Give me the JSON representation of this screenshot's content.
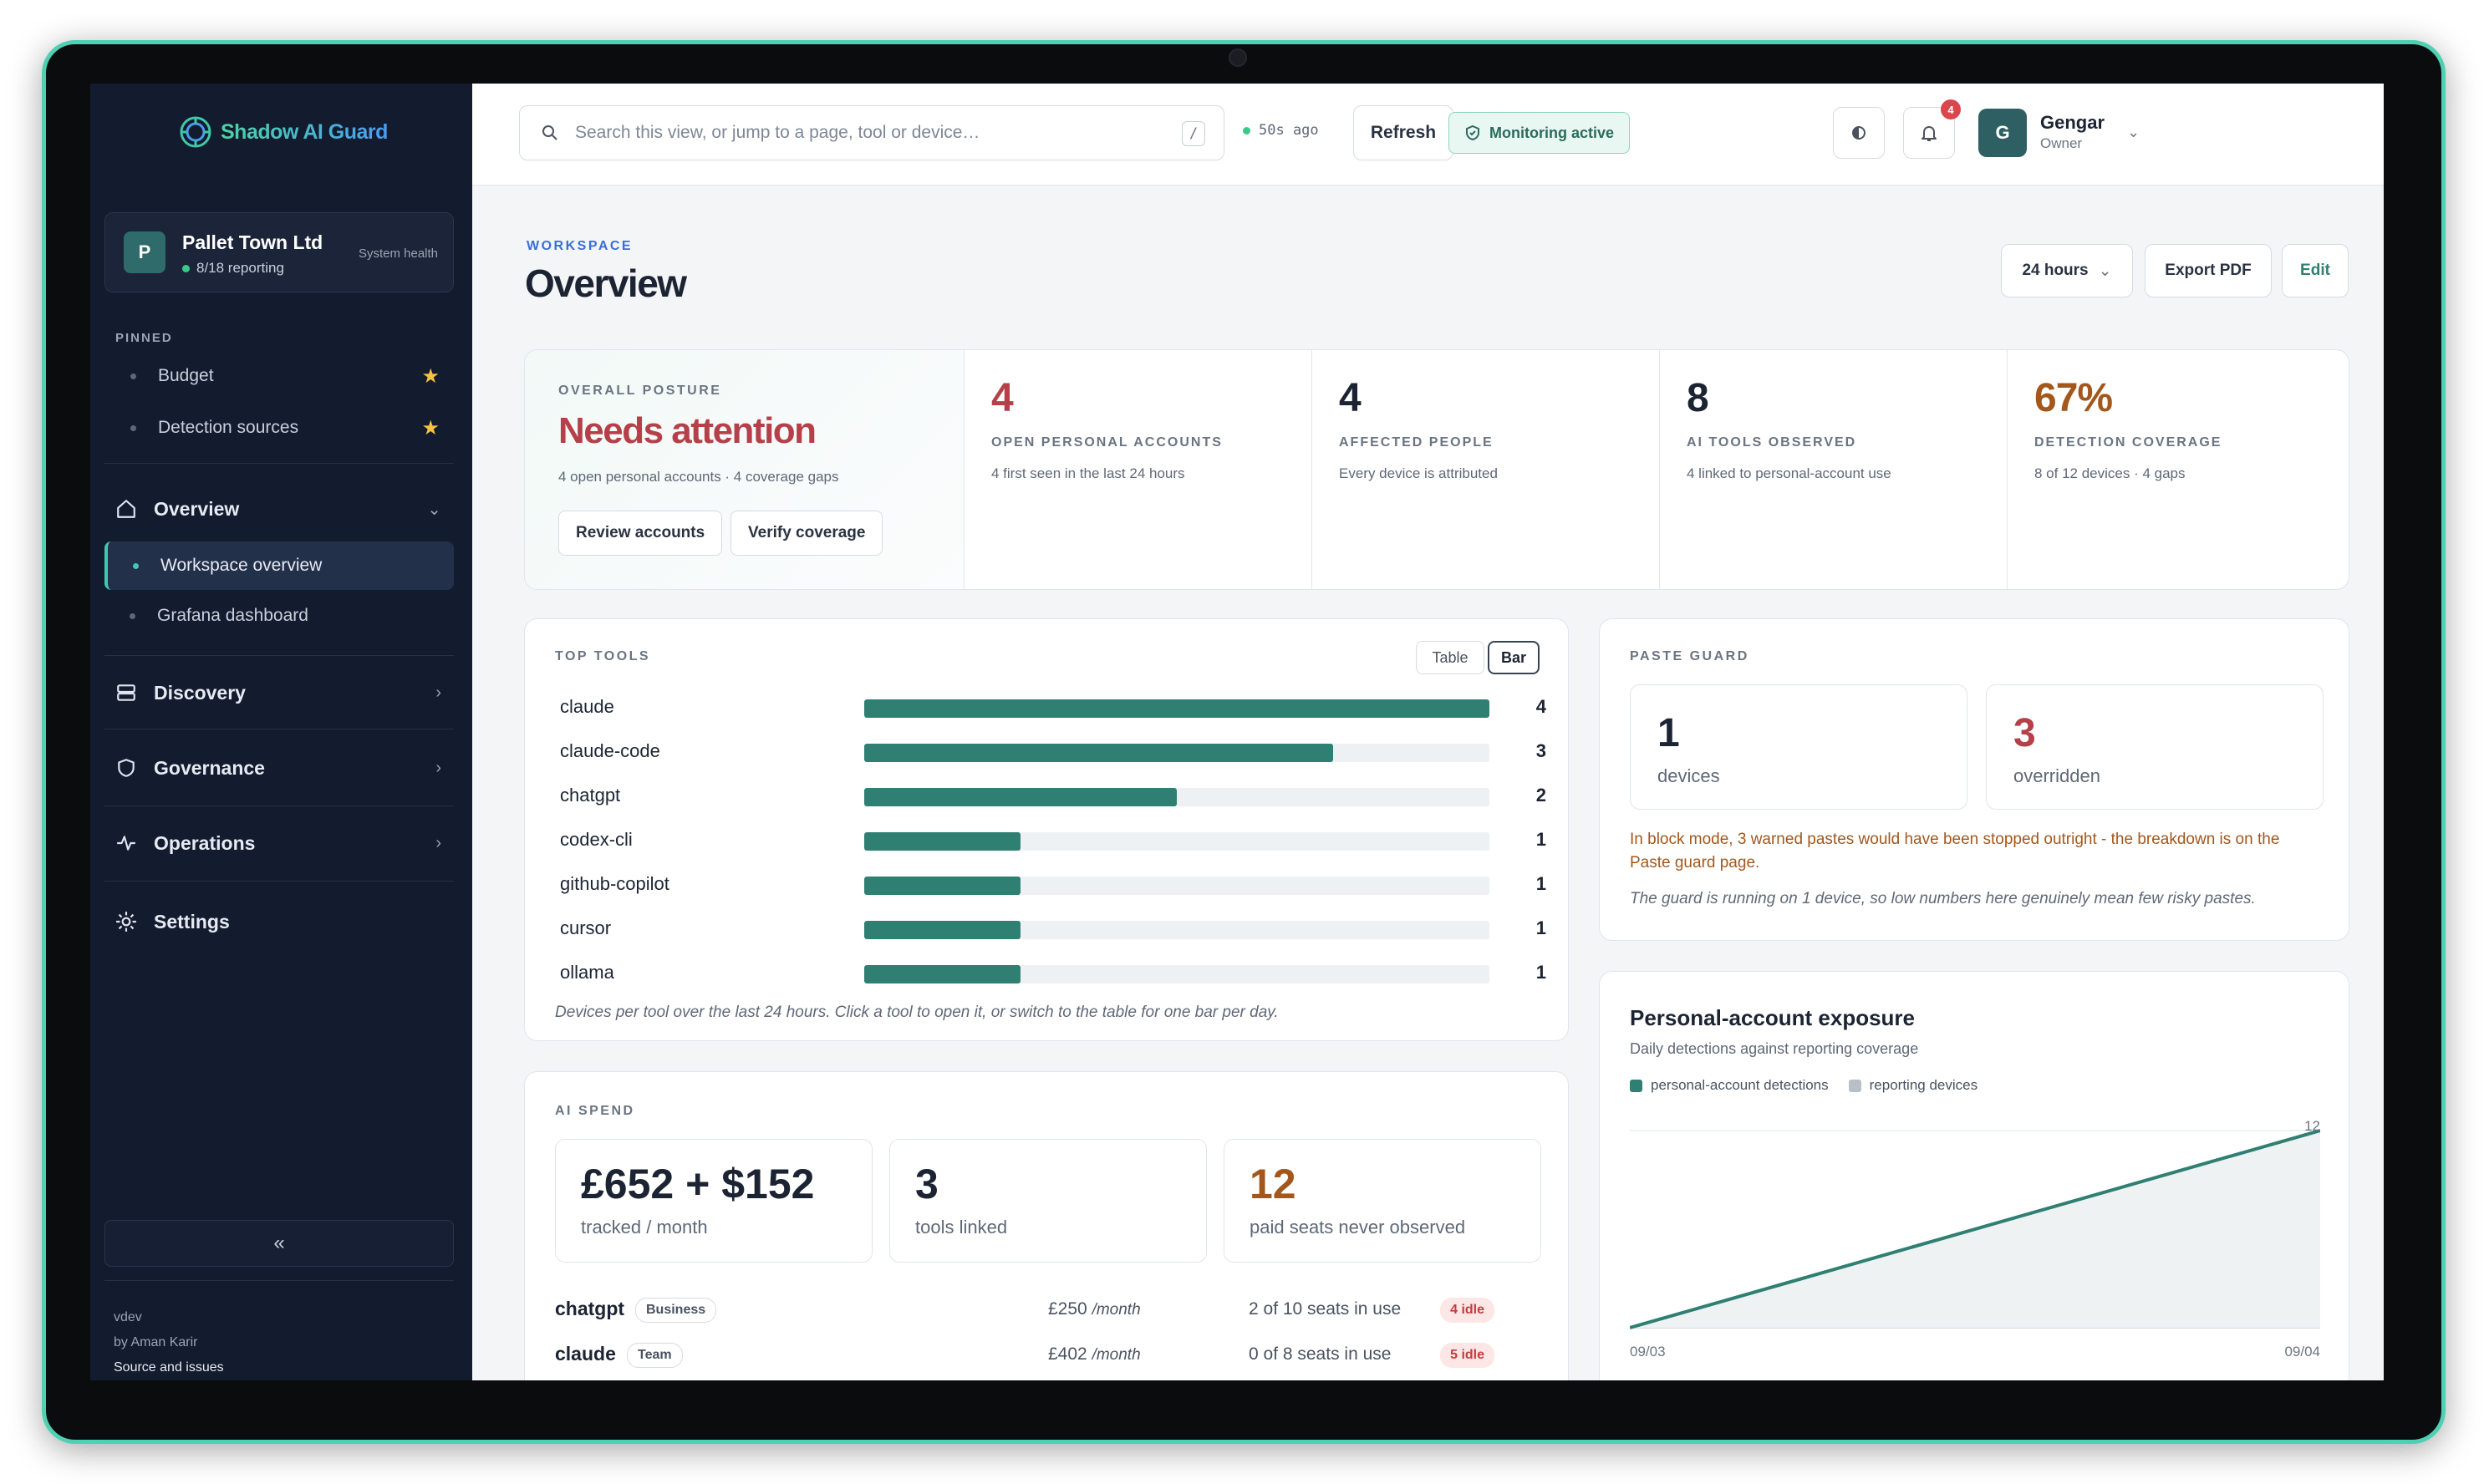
{
  "app": {
    "name": "Shadow AI Guard"
  },
  "org": {
    "name": "Pallet Town Ltd",
    "status": "8/18 reporting",
    "health_label": "System health",
    "avatar": "P"
  },
  "sidebar": {
    "pinned_label": "PINNED",
    "pinned": [
      {
        "label": "Budget",
        "icon": "star-icon"
      },
      {
        "label": "Detection sources",
        "icon": "star-icon"
      }
    ],
    "groups": {
      "overview": {
        "label": "Overview",
        "icon": "home-icon",
        "items": [
          {
            "label": "Workspace overview",
            "active": true
          },
          {
            "label": "Grafana dashboard"
          }
        ]
      },
      "discovery": {
        "label": "Discovery",
        "icon": "stack-icon"
      },
      "governance": {
        "label": "Governance",
        "icon": "shield-icon"
      },
      "operations": {
        "label": "Operations",
        "icon": "pulse-icon"
      },
      "settings": {
        "label": "Settings",
        "icon": "gear-icon"
      }
    },
    "collapse_label": "«",
    "footer": {
      "version": "vdev",
      "author": "by Aman Karir",
      "source": "Source and issues"
    }
  },
  "topbar": {
    "search_placeholder": "Search this view, or jump to a page, tool or device…",
    "search_shortcut": "/",
    "last_update": "50s ago",
    "refresh_label": "Refresh",
    "monitoring_label": "Monitoring active",
    "notifications_count": "4",
    "user": {
      "name": "Gengar",
      "role": "Owner",
      "avatar": "G"
    }
  },
  "page": {
    "kicker": "WORKSPACE",
    "title": "Overview",
    "range_label": "24 hours",
    "export_label": "Export PDF",
    "edit_label": "Edit"
  },
  "posture": {
    "eyebrow": "OVERALL POSTURE",
    "status": "Needs attention",
    "summary": "4 open personal accounts · 4 coverage gaps",
    "review_label": "Review accounts",
    "verify_label": "Verify coverage",
    "stats": [
      {
        "value": "4",
        "label": "OPEN PERSONAL ACCOUNTS",
        "desc": "4 first seen in the last 24 hours",
        "color": "#b5404a"
      },
      {
        "value": "4",
        "label": "AFFECTED PEOPLE",
        "desc": "Every device is attributed",
        "color": "#1c2433"
      },
      {
        "value": "8",
        "label": "AI TOOLS OBSERVED",
        "desc": "4 linked to personal-account use",
        "color": "#1c2433"
      },
      {
        "value": "67%",
        "label": "DETECTION COVERAGE",
        "desc": "8 of 12 devices · 4 gaps",
        "color": "#a3571c"
      }
    ]
  },
  "top_tools": {
    "eyebrow": "TOP TOOLS",
    "toggle_table": "Table",
    "toggle_bar": "Bar",
    "max": 4,
    "rows": [
      {
        "name": "claude",
        "value": 4
      },
      {
        "name": "claude-code",
        "value": 3
      },
      {
        "name": "chatgpt",
        "value": 2
      },
      {
        "name": "codex-cli",
        "value": 1
      },
      {
        "name": "github-copilot",
        "value": 1
      },
      {
        "name": "cursor",
        "value": 1
      },
      {
        "name": "ollama",
        "value": 1
      }
    ],
    "note": "Devices per tool over the last 24 hours. Click a tool to open it, or switch to the table for one bar per day."
  },
  "paste_guard": {
    "eyebrow": "PASTE GUARD",
    "devices_value": "1",
    "devices_label": "devices",
    "overridden_value": "3",
    "overridden_label": "overridden",
    "warning": "In block mode, 3 warned pastes would have been stopped outright - the breakdown is on the Paste guard page.",
    "note": "The guard is running on 1 device, so low numbers here genuinely mean few risky pastes."
  },
  "exposure": {
    "title": "Personal-account exposure",
    "subtitle": "Daily detections against reporting coverage",
    "legend_detections": "personal-account detections",
    "legend_devices": "reporting devices",
    "peak_label": "12",
    "x_start": "09/03",
    "x_end": "09/04"
  },
  "chart_data": {
    "type": "area",
    "title": "Personal-account exposure",
    "subtitle": "Daily detections against reporting coverage",
    "x": [
      "09/03",
      "09/04"
    ],
    "series": [
      {
        "name": "personal-account detections",
        "values": [
          0,
          12
        ],
        "color": "#2f7f73"
      },
      {
        "name": "reporting devices",
        "values": [
          0,
          12
        ],
        "color": "#b9bfc6"
      }
    ],
    "ylim": [
      0,
      12
    ],
    "legend": "top-left"
  },
  "spend": {
    "eyebrow": "AI SPEND",
    "tracked_value": "£652 + $152",
    "tracked_label": "tracked / month",
    "tools_value": "3",
    "tools_label": "tools linked",
    "seats_value": "12",
    "seats_label": "paid seats never observed",
    "rows": [
      {
        "name": "chatgpt",
        "plan": "Business",
        "price": "£250",
        "period": "/month",
        "seats": "2 of 10 seats in use",
        "idle": "4 idle"
      },
      {
        "name": "claude",
        "plan": "Team",
        "price": "£402",
        "period": "/month",
        "seats": "0 of 8 seats in use",
        "idle": "5 idle"
      }
    ]
  },
  "colors": {
    "accent": "#2f7f73",
    "danger": "#b5404a",
    "warning": "#a3571c",
    "sidebar": "#131b2e"
  }
}
